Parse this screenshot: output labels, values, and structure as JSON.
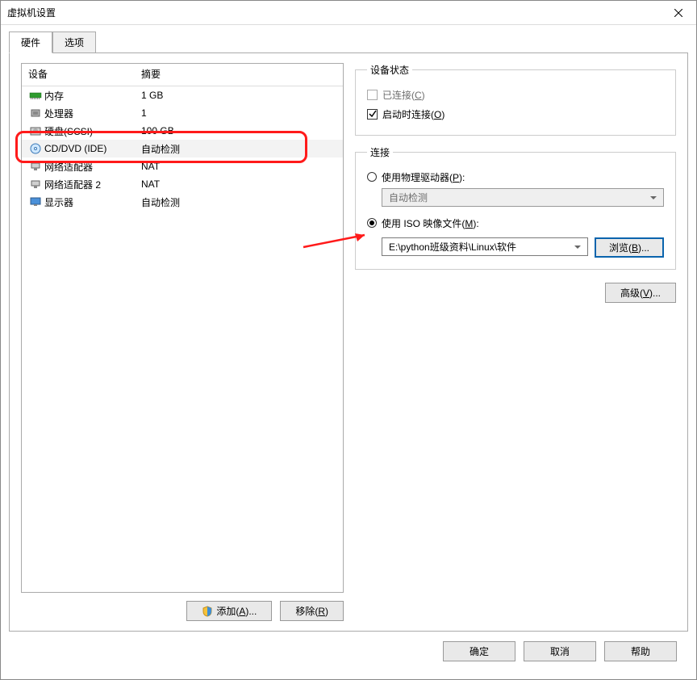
{
  "title": "虚拟机设置",
  "tabs": {
    "hardware": "硬件",
    "options": "选项"
  },
  "device_header": {
    "device": "设备",
    "summary": "摘要"
  },
  "devices": [
    {
      "name": "内存",
      "summary": "1 GB",
      "icon": "memory"
    },
    {
      "name": "处理器",
      "summary": "1",
      "icon": "cpu"
    },
    {
      "name": "硬盘(SCSI)",
      "summary": "100 GB",
      "icon": "disk"
    },
    {
      "name": "CD/DVD (IDE)",
      "summary": "自动检测",
      "icon": "cd"
    },
    {
      "name": "网络适配器",
      "summary": "NAT",
      "icon": "net"
    },
    {
      "name": "网络适配器 2",
      "summary": "NAT",
      "icon": "net"
    },
    {
      "name": "显示器",
      "summary": "自动检测",
      "icon": "display"
    }
  ],
  "buttons": {
    "add": "添加(",
    "add_k": "A",
    "add_sfx": ")...",
    "remove": "移除(",
    "remove_k": "R",
    "remove_sfx": ")",
    "browse": "浏览(",
    "browse_k": "B",
    "browse_sfx": ")...",
    "advanced": "高级(",
    "advanced_k": "V",
    "advanced_sfx": ")...",
    "ok": "确定",
    "cancel": "取消",
    "help": "帮助"
  },
  "groups": {
    "status": "设备状态",
    "connection": "连接"
  },
  "status": {
    "connected_lbl": "已连接(",
    "connected_k": "C",
    "connected_sfx": ")",
    "connect_on_start_lbl": "启动时连接(",
    "connect_on_start_k": "O",
    "connect_on_start_sfx": ")"
  },
  "connection": {
    "physical_lbl": "使用物理驱动器(",
    "physical_k": "P",
    "physical_sfx": "):",
    "physical_value": "自动检测",
    "iso_lbl": "使用 ISO 映像文件(",
    "iso_k": "M",
    "iso_sfx": "):",
    "iso_value": "E:\\python班级资料\\Linux\\软件"
  }
}
